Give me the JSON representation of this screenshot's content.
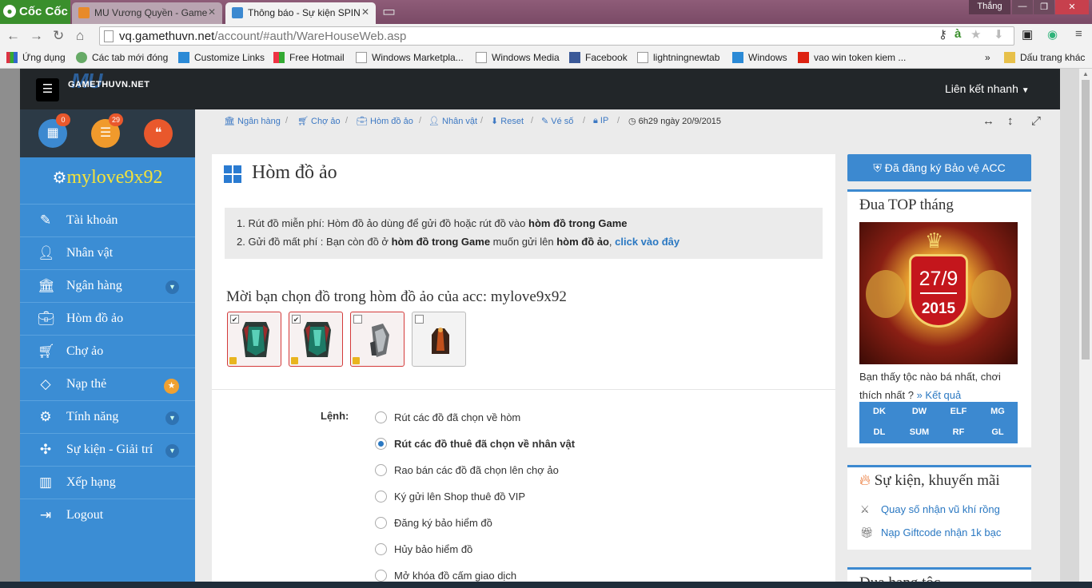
{
  "browser": {
    "brand": "Cốc Cốc",
    "tabs": [
      {
        "title": "MU Vương Quyền - Game",
        "icon_color": "#e88a2a"
      },
      {
        "title": "Thông báo - Sự kiện SPIN",
        "icon_color": "#3c89d0"
      }
    ],
    "window_user": "Thắng",
    "url_host": "vq.gamethuvn.net",
    "url_path": "/account/#auth/WareHouseWeb.asp",
    "bookmarks": [
      "Ứng dụng",
      "Các tab mới đóng",
      "Customize Links",
      "Free Hotmail",
      "Windows Marketpla...",
      "Windows Media",
      "Facebook",
      "lightningnewtab",
      "Windows",
      "vao win token kiem ...",
      "»",
      "Dấu trang khác"
    ]
  },
  "site": {
    "logo_big": "MU",
    "logo_text": "GAMETHUVN.NET",
    "quick_links": "Liên kết nhanh",
    "sidebar": {
      "badges": {
        "calendar": "0",
        "list": "29"
      },
      "username": "mylove9x92",
      "items": [
        {
          "label": "Tài khoản",
          "icon": "edit-icon"
        },
        {
          "label": "Nhân vật",
          "icon": "user-icon"
        },
        {
          "label": "Ngân hàng",
          "icon": "bank-icon"
        },
        {
          "label": "Hòm đồ ảo",
          "icon": "briefcase-icon"
        },
        {
          "label": "Chợ ảo",
          "icon": "cart-icon"
        },
        {
          "label": "Nạp thẻ",
          "icon": "diamond-icon"
        },
        {
          "label": "Tính năng",
          "icon": "gears-icon"
        },
        {
          "label": "Sự kiện - Giải trí",
          "icon": "gamepad-icon"
        },
        {
          "label": "Xếp hạng",
          "icon": "chart-icon"
        },
        {
          "label": "Logout",
          "icon": "logout-icon"
        }
      ]
    },
    "breadcrumbs": [
      "Ngân hàng",
      "Chợ ảo",
      "Hòm đồ ảo",
      "Nhân vật",
      "Reset",
      "Vé số",
      "IP"
    ],
    "time_text": "6h29 ngày 20/9/2015",
    "main": {
      "title": "Hòm đồ ảo",
      "notice_1_pre": "1. Rút đồ miễn phí: Hòm đồ ảo dùng để gửi đồ hoặc rút đồ vào ",
      "notice_1_bold": "hòm đồ trong Game",
      "notice_2_pre": "2. Gửi đồ mất phí : Bạn còn đồ ở ",
      "notice_2_bold1": "hòm đồ trong Game",
      "notice_2_mid": " muốn gửi lên ",
      "notice_2_bold2": "hòm đồ ảo",
      "notice_2_comma": ", ",
      "notice_2_link": "click vào đây",
      "choose_text": "Mời bạn chọn đồ trong hòm đồ ảo của acc: mylove9x92",
      "items": [
        {
          "checked": true,
          "locked": true
        },
        {
          "checked": true,
          "locked": true
        },
        {
          "checked": false,
          "locked": true
        },
        {
          "checked": false,
          "locked": false
        }
      ],
      "command_label": "Lệnh:",
      "options": [
        "Rút các đồ đã chọn về hòm",
        "Rút các đồ thuê đã chọn về nhân vật",
        "Rao bán các đồ đã chọn lên chợ ảo",
        "Ký gửi lên Shop thuê đồ VIP",
        "Đăng ký bảo hiểm đồ",
        "Hủy bảo hiểm đồ",
        "Mở khóa đồ cấm giao dịch"
      ],
      "selected_option": 1
    },
    "right": {
      "protect_button": "Đã đăng ký Bảo vệ ACC",
      "top_title": "Đua TOP tháng",
      "top_date": "27/9",
      "top_year": "2015",
      "top_text": "Bạn thấy tộc nào bá nhất, chơi thích nhất ?",
      "top_link": "» Kết quả",
      "classes": [
        "DK",
        "DW",
        "ELF",
        "MG",
        "DL",
        "SUM",
        "RF",
        "GL"
      ],
      "events_title": "Sự kiện, khuyến mãi",
      "events": [
        "Quay số nhận vũ khí rồng",
        "Nạp Giftcode nhận 1k bạc"
      ],
      "next_title": "Đua hạng tộc"
    }
  }
}
